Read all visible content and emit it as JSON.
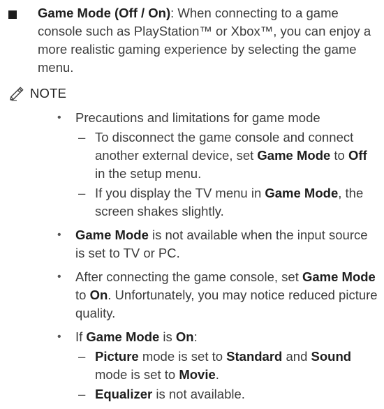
{
  "game_mode": {
    "title": "Game Mode (Off / On)",
    "description": ": When connecting to a game console such as PlayStation™ or Xbox™, you can enjoy a more realistic gaming experience by selecting the game menu."
  },
  "note": {
    "label": "NOTE",
    "bullet1": {
      "text": "Precautions and limitations for game mode",
      "sub1": {
        "t1": "To disconnect the game console and connect another external device, set ",
        "b1": "Game Mode",
        "t2": " to ",
        "b2": "Off",
        "t3": " in the setup menu."
      },
      "sub2": {
        "t1": "If you display the TV menu in ",
        "b1": "Game Mode",
        "t2": ", the screen shakes slightly."
      }
    },
    "bullet2": {
      "b1": "Game Mode",
      "t1": " is not available when the input source is set to TV or PC."
    },
    "bullet3": {
      "t1": "After connecting the game console, set ",
      "b1": "Game Mode",
      "t2": " to ",
      "b2": "On",
      "t3": ". Unfortunately, you may notice reduced picture quality."
    },
    "bullet4": {
      "t1": "If ",
      "b1": "Game Mode",
      "t2": " is ",
      "b2": "On",
      "t3": ":",
      "sub1": {
        "b1": "Picture",
        "t1": " mode is set to ",
        "b2": "Standard",
        "t2": " and ",
        "b3": "Sound",
        "t3": " mode is set to ",
        "b4": "Movie",
        "t4": "."
      },
      "sub2": {
        "b1": "Equalizer",
        "t1": " is not available."
      }
    }
  }
}
